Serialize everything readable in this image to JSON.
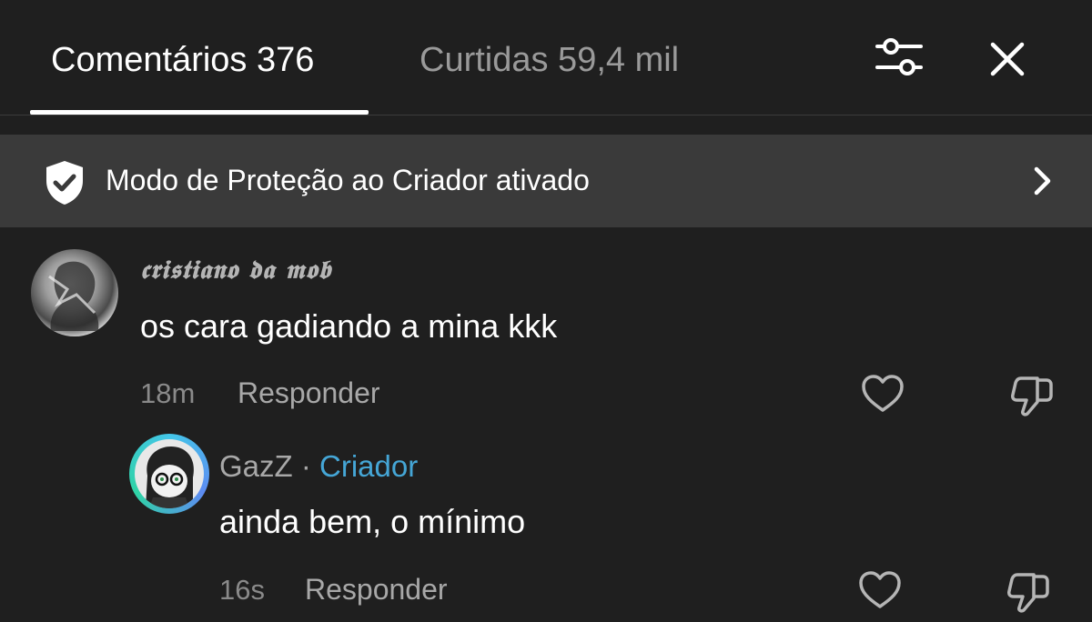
{
  "tabs": {
    "comments_label": "Comentários 376",
    "likes_label": "Curtidas 59,4 mil"
  },
  "header_icons": {
    "filter": "sliders-icon",
    "close": "close-icon"
  },
  "banner": {
    "icon": "shield-check-icon",
    "text": "Modo de Proteção ao Criador ativado",
    "chevron": "chevron-right-icon"
  },
  "comments": [
    {
      "username": "𝖈𝖗𝖎𝖘𝖙𝖎𝖆𝖓𝖔 𝖉𝖆 𝖒𝖔𝖇",
      "text": "os cara gadiando a mina kkk",
      "time": "18m",
      "reply_label": "Responder"
    },
    {
      "username": "GazZ",
      "separator": "·",
      "badge": "Criador",
      "text": "ainda bem, o mínimo",
      "time": "16s",
      "reply_label": "Responder"
    }
  ],
  "colors": {
    "background": "#1f1f1f",
    "banner_bg": "#3a3a3a",
    "creator_badge": "#45a6d6",
    "muted_text": "#a8a8a8"
  }
}
